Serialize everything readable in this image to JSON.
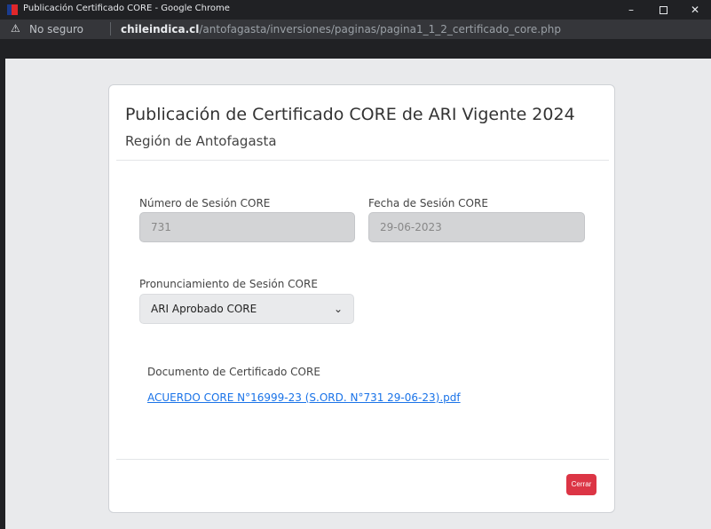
{
  "window": {
    "title": "Publicación Certificado CORE - Google Chrome",
    "controls": {
      "minimize": "–",
      "close": "✕"
    }
  },
  "addressbar": {
    "warning_icon": "⚠",
    "security_label": "No seguro",
    "url_domain": "chileindica.cl",
    "url_path": "/antofagasta/inversiones/paginas/pagina1_1_2_certificado_core.php"
  },
  "modal": {
    "title": "Publicación de Certificado CORE de ARI Vigente 2024",
    "subtitle": "Región de Antofagasta",
    "session_number": {
      "label": "Número de Sesión CORE",
      "value": "731"
    },
    "session_date": {
      "label": "Fecha de Sesión CORE",
      "value": "29-06-2023"
    },
    "pronouncement": {
      "label": "Pronunciamiento de Sesión CORE",
      "selected": "ARI Aprobado CORE",
      "chevron": "⌄"
    },
    "document": {
      "label": "Documento de Certificado CORE",
      "link": "ACUERDO CORE N°16999-23 (S.ORD. N°731 29-06-23).pdf"
    },
    "close_button": "Cerrar"
  },
  "colors": {
    "accent_red": "#dc3545",
    "link_blue": "#1a73e8",
    "chrome_dark": "#202124"
  }
}
